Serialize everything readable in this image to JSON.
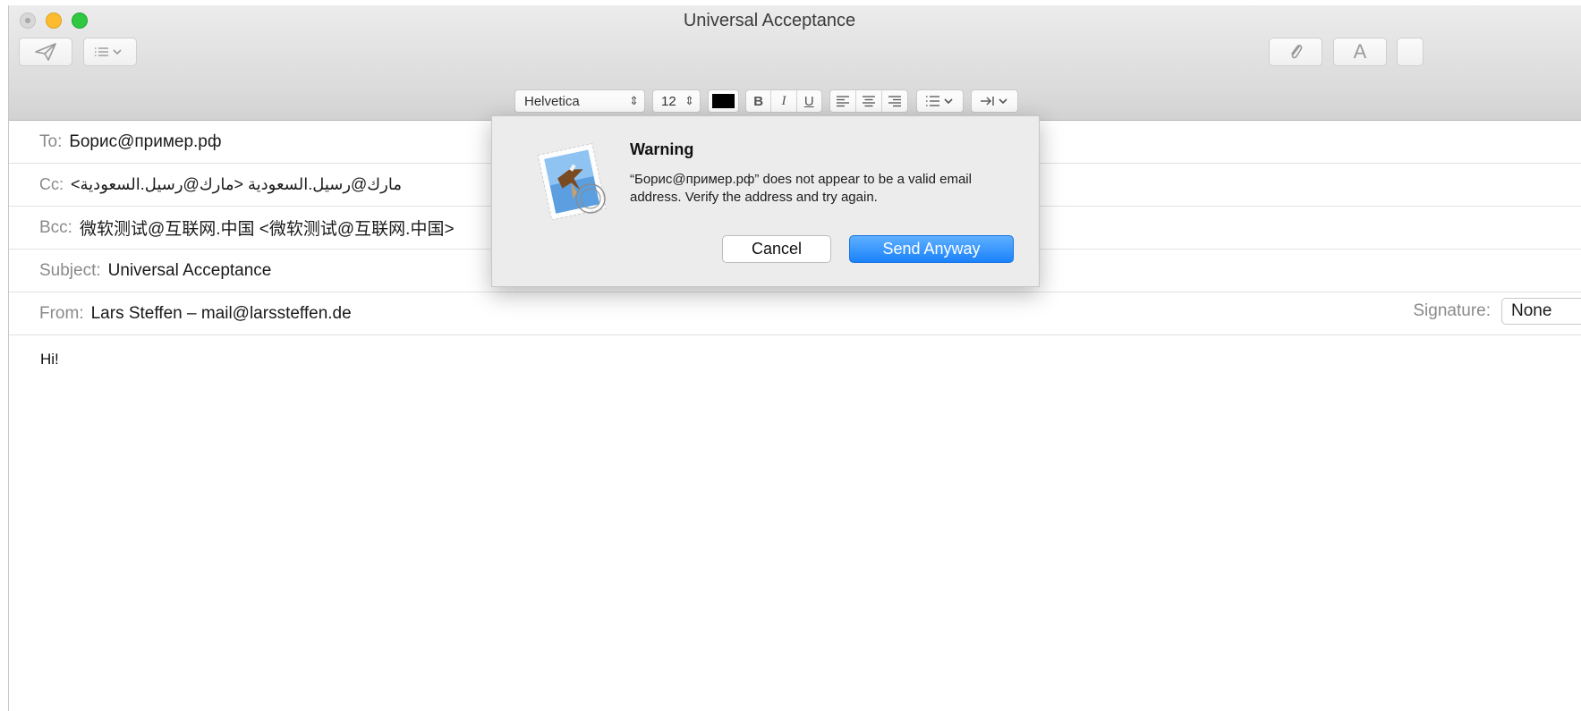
{
  "window": {
    "title": "Universal Acceptance"
  },
  "toolbar": {
    "send_icon": "paper-plane-icon",
    "header_options_icon": "list-chevron-icon",
    "attach_icon": "paperclip-icon",
    "fonts_label": "A"
  },
  "formatbar": {
    "font_family": "Helvetica",
    "font_size": "12",
    "text_color": "#000000",
    "bold": "B",
    "italic": "I",
    "underline": "U"
  },
  "header": {
    "to_label": "To:",
    "to_value": "Борис@пример.рф",
    "cc_label": "Cc:",
    "cc_value": "مارك@رسيل.السعودية <مارك@رسيل.السعودية>",
    "bcc_label": "Bcc:",
    "bcc_value": "微软测试@互联网.中国 <微软测试@互联网.中国>",
    "subject_label": "Subject:",
    "subject_value": "Universal Acceptance",
    "from_label": "From:",
    "from_value": "Lars Steffen – mail@larssteffen.de",
    "signature_label": "Signature:",
    "signature_value": "None"
  },
  "body": {
    "text": "Hi!"
  },
  "dialog": {
    "title": "Warning",
    "message": "“Борис@пример.рф” does not appear to be a valid email address. Verify the address and try again.",
    "cancel_label": "Cancel",
    "confirm_label": "Send Anyway"
  },
  "colors": {
    "accent": "#1a82fb",
    "close_traffic": "#d8d8d8",
    "min_traffic": "#fdbb2f",
    "max_traffic": "#2fc840"
  }
}
